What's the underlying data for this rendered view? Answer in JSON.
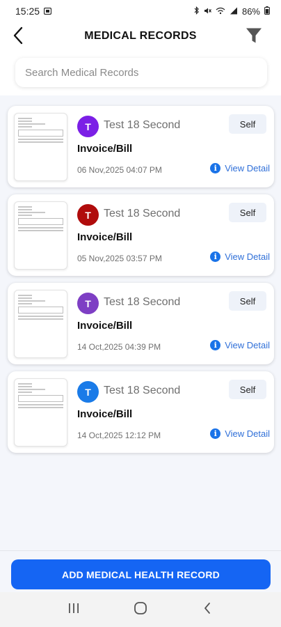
{
  "status_bar": {
    "time": "15:25",
    "battery": "86%",
    "icons": [
      "screenshot-icon",
      "bluetooth-icon",
      "mute-icon",
      "wifi-icon",
      "signal-icon",
      "battery-icon"
    ]
  },
  "header": {
    "title": "MEDICAL RECORDS",
    "back_icon": "arrow-back-icon",
    "filter_icon": "filter-icon"
  },
  "search": {
    "placeholder": "Search Medical Records",
    "value": ""
  },
  "records": [
    {
      "avatar_letter": "T",
      "avatar_color": "#7b1fe6",
      "patient_name": "Test 18 Second",
      "badge": "Self",
      "record_type": "Invoice/Bill",
      "date": "06 Nov,2025 04:07 PM",
      "action_label": "View Detail"
    },
    {
      "avatar_letter": "T",
      "avatar_color": "#b00c0c",
      "patient_name": "Test 18 Second",
      "badge": "Self",
      "record_type": "Invoice/Bill",
      "date": "05 Nov,2025 03:57 PM",
      "action_label": "View Detail"
    },
    {
      "avatar_letter": "T",
      "avatar_color": "#7e3fc4",
      "patient_name": "Test 18 Second",
      "badge": "Self",
      "record_type": "Invoice/Bill",
      "date": "14 Oct,2025 04:39 PM",
      "action_label": "View Detail"
    },
    {
      "avatar_letter": "T",
      "avatar_color": "#1a7be8",
      "patient_name": "Test 18 Second",
      "badge": "Self",
      "record_type": "Invoice/Bill",
      "date": "14 Oct,2025 12:12 PM",
      "action_label": "View Detail"
    }
  ],
  "footer": {
    "add_button_label": "ADD MEDICAL HEALTH RECORD"
  },
  "colors": {
    "primary": "#1565f3",
    "link": "#2f6fd8",
    "background": "#f4f6fb"
  },
  "nav": {
    "icons": [
      "recents-icon",
      "home-icon",
      "back-icon"
    ]
  }
}
